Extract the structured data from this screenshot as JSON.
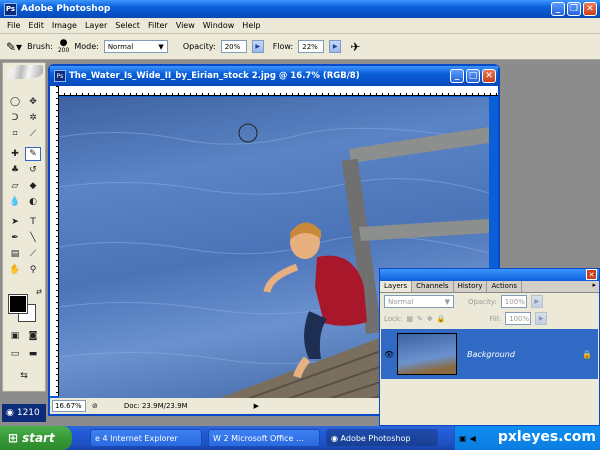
{
  "app": {
    "title": "Adobe Photoshop",
    "logo": "Ps"
  },
  "menu": [
    "File",
    "Edit",
    "Image",
    "Layer",
    "Select",
    "Filter",
    "View",
    "Window",
    "Help"
  ],
  "options": {
    "brush_label": "Brush:",
    "brush_size": "200",
    "mode_label": "Mode:",
    "mode_value": "Normal",
    "opacity_label": "Opacity:",
    "opacity_value": "20%",
    "flow_label": "Flow:",
    "flow_value": "22%"
  },
  "document": {
    "title": "The_Water_Is_Wide_II_by_Eirian_stock 2.jpg @ 16.7% (RGB/8)",
    "zoom": "16.67%",
    "doc_size": "Doc: 23.9M/23.9M"
  },
  "layers_panel": {
    "tabs": [
      "Layers",
      "Channels",
      "History",
      "Actions"
    ],
    "blend_mode": "Normal",
    "opacity_label": "Opacity:",
    "opacity_value": "100%",
    "lock_label": "Lock:",
    "fill_label": "Fill:",
    "fill_value": "100%",
    "layer_name": "Background"
  },
  "taskbar": {
    "start_label": "start",
    "tasks": [
      "4 Internet Explorer",
      "2 Microsoft Office ...",
      "Adobe Photoshop"
    ],
    "side_label": "1210"
  },
  "watermark": "pxleyes.com",
  "colors": {
    "xp_blue": "#0a5fd8",
    "start_green": "#379a37",
    "selection": "#316ac5"
  }
}
